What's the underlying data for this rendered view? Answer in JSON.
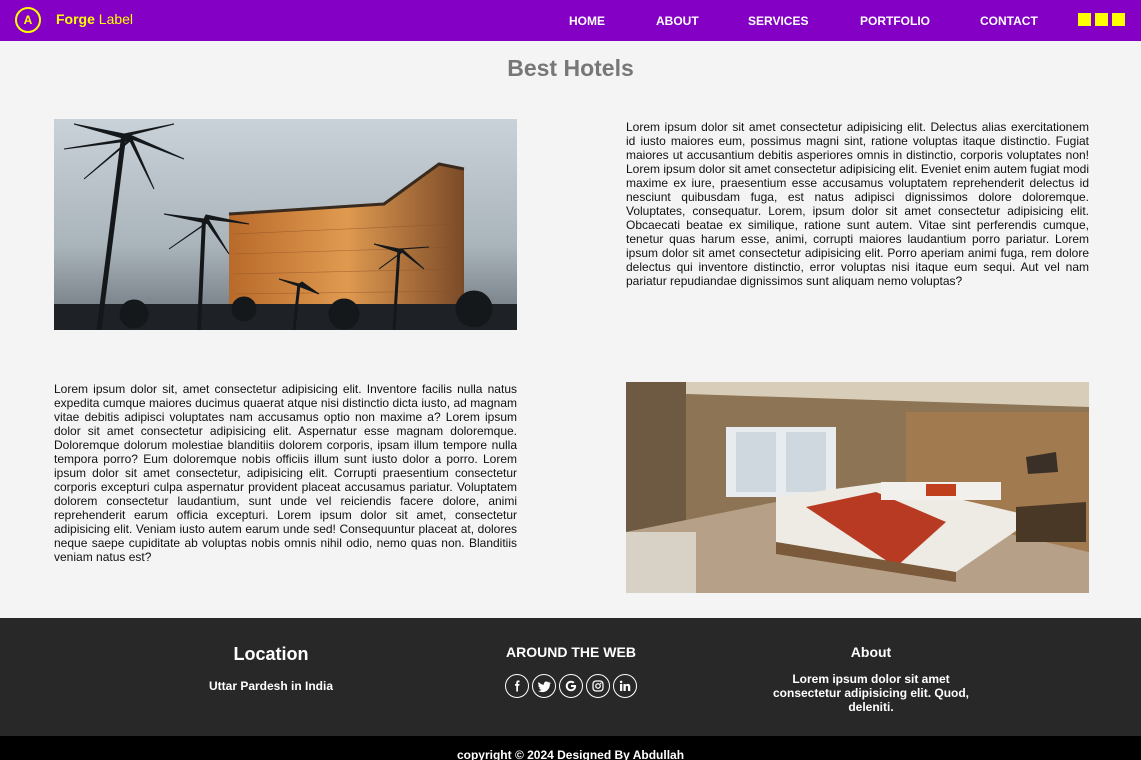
{
  "nav": {
    "logo_letter": "A",
    "brand_bold": "Forge",
    "brand_rest": " Label",
    "links": [
      "HOME",
      "ABOUT",
      "SERVICES",
      "PORTFOLIO",
      "CONTACT"
    ],
    "accent_color": "#ffff00",
    "bar_color": "#8300c4"
  },
  "main": {
    "title": "Best Hotels",
    "sections": [
      {
        "image": "hotel-exterior-palm-trees",
        "text": "Lorem ipsum dolor sit amet consectetur adipisicing elit. Delectus alias exercitationem id iusto maiores eum, possimus magni sint, ratione voluptas itaque distinctio. Fugiat maiores ut accusantium debitis asperiores omnis in distinctio, corporis voluptates non! Lorem ipsum dolor sit amet consectetur adipisicing elit. Eveniet enim autem fugiat modi maxime ex iure, praesentium esse accusamus voluptatem reprehenderit delectus id nesciunt quibusdam fuga, est natus adipisci dignissimos dolore doloremque. Voluptates, consequatur. Lorem, ipsum dolor sit amet consectetur adipisicing elit. Obcaecati beatae ex similique, ratione sunt autem. Vitae sint perferendis cumque, tenetur quas harum esse, animi, corrupti maiores laudantium porro pariatur. Lorem ipsum dolor sit amet consectetur adipisicing elit. Porro aperiam animi fuga, rem dolore delectus qui inventore distinctio, error voluptas nisi itaque eum sequi. Aut vel nam pariatur repudiandae dignissimos sunt aliquam nemo voluptas?"
      },
      {
        "image": "hotel-bedroom-interior",
        "text": "Lorem ipsum dolor sit, amet consectetur adipisicing elit. Inventore facilis nulla natus expedita cumque maiores ducimus quaerat atque nisi distinctio dicta iusto, ad magnam vitae debitis adipisci voluptates nam accusamus optio non maxime a? Lorem ipsum dolor sit amet consectetur adipisicing elit. Aspernatur esse magnam doloremque. Doloremque dolorum molestiae blanditiis dolorem corporis, ipsam illum tempore nulla tempora porro? Eum doloremque nobis officiis illum sunt iusto dolor a porro. Lorem ipsum dolor sit amet consectetur, adipisicing elit. Corrupti praesentium consectetur corporis excepturi culpa aspernatur provident placeat accusamus pariatur. Voluptatem dolorem consectetur laudantium, sunt unde vel reiciendis facere dolore, animi reprehenderit earum officia excepturi. Lorem ipsum dolor sit amet, consectetur adipisicing elit. Veniam iusto autem earum unde sed! Consequuntur placeat at, dolores neque saepe cupiditate ab voluptas nobis omnis nihil odio, nemo quas non. Blanditiis veniam natus est?"
      }
    ]
  },
  "footer": {
    "location_heading": "Location",
    "location_text": "Uttar Pardesh in India",
    "web_heading": "AROUND THE WEB",
    "social_icons": [
      "facebook-icon",
      "twitter-icon",
      "google-icon",
      "instagram-icon",
      "linkedin-icon"
    ],
    "about_heading": "About",
    "about_text": "Lorem ipsum dolor sit amet consectetur adipisicing elit. Quod, deleniti.",
    "copyright": "copyright © 2024 Designed By Abdullah"
  }
}
